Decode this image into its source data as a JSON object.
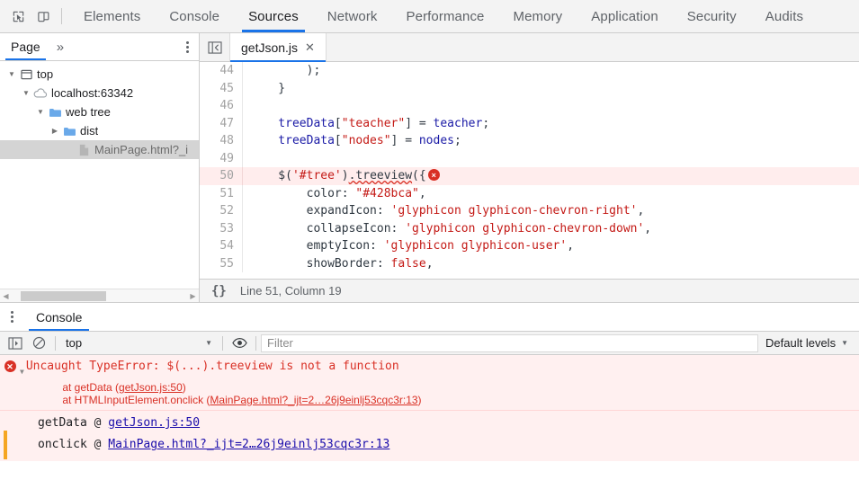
{
  "toolbar": {
    "inspect_icon": "inspect-cursor-icon",
    "device_icon": "device-toolbar-icon",
    "tabs": [
      {
        "label": "Elements",
        "active": false
      },
      {
        "label": "Console",
        "active": false
      },
      {
        "label": "Sources",
        "active": true
      },
      {
        "label": "Network",
        "active": false
      },
      {
        "label": "Performance",
        "active": false
      },
      {
        "label": "Memory",
        "active": false
      },
      {
        "label": "Application",
        "active": false
      },
      {
        "label": "Security",
        "active": false
      },
      {
        "label": "Audits",
        "active": false
      }
    ],
    "accent_color": "#1a73e8"
  },
  "navigator": {
    "tab_label": "Page",
    "more_label": "»",
    "menu_icon": "more-options-icon",
    "tree": [
      {
        "label": "top",
        "icon": "frame-icon",
        "twisty": "▼",
        "indent": 6,
        "selected": false
      },
      {
        "label": "localhost:63342",
        "icon": "cloud-icon",
        "twisty": "▼",
        "indent": 22,
        "selected": false
      },
      {
        "label": "web tree",
        "icon": "folder-icon",
        "twisty": "▼",
        "indent": 38,
        "selected": false
      },
      {
        "label": "dist",
        "icon": "folder-icon",
        "twisty": "▶",
        "indent": 54,
        "selected": false
      },
      {
        "label": "MainPage.html?_i",
        "icon": "file-icon",
        "twisty": "",
        "indent": 70,
        "selected": true
      }
    ]
  },
  "editor": {
    "panel_toggle_icon": "show-navigator-icon",
    "tab": {
      "label": "getJson.js",
      "close_icon": "close-icon"
    },
    "lines": [
      {
        "num": "44",
        "error": false,
        "tokens": [
          {
            "t": "        );",
            "c": "plain"
          }
        ]
      },
      {
        "num": "45",
        "error": false,
        "tokens": [
          {
            "t": "    }",
            "c": "plain"
          }
        ]
      },
      {
        "num": "46",
        "error": false,
        "tokens": [
          {
            "t": "",
            "c": "plain"
          }
        ]
      },
      {
        "num": "47",
        "error": false,
        "tokens": [
          {
            "t": "    treeData",
            "c": "id"
          },
          {
            "t": "[",
            "c": "plain"
          },
          {
            "t": "\"teacher\"",
            "c": "str"
          },
          {
            "t": "] = ",
            "c": "plain"
          },
          {
            "t": "teacher",
            "c": "id"
          },
          {
            "t": ";",
            "c": "plain"
          }
        ]
      },
      {
        "num": "48",
        "error": false,
        "tokens": [
          {
            "t": "    treeData",
            "c": "id"
          },
          {
            "t": "[",
            "c": "plain"
          },
          {
            "t": "\"nodes\"",
            "c": "str"
          },
          {
            "t": "] = ",
            "c": "plain"
          },
          {
            "t": "nodes",
            "c": "id"
          },
          {
            "t": ";",
            "c": "plain"
          }
        ]
      },
      {
        "num": "49",
        "error": false,
        "tokens": [
          {
            "t": "",
            "c": "plain"
          }
        ]
      },
      {
        "num": "50",
        "error": true,
        "tokens": [
          {
            "t": "    $(",
            "c": "plain"
          },
          {
            "t": "'#tree'",
            "c": "str"
          },
          {
            "t": ")",
            "c": "plain"
          },
          {
            "t": ".treeview",
            "c": "squig"
          },
          {
            "t": "({",
            "c": "plain"
          }
        ],
        "badge": "×"
      },
      {
        "num": "51",
        "error": false,
        "tokens": [
          {
            "t": "        color: ",
            "c": "plain"
          },
          {
            "t": "\"#428bca\"",
            "c": "str"
          },
          {
            "t": ",",
            "c": "plain"
          }
        ]
      },
      {
        "num": "52",
        "error": false,
        "tokens": [
          {
            "t": "        expandIcon: ",
            "c": "plain"
          },
          {
            "t": "'glyphicon glyphicon-chevron-right'",
            "c": "str"
          },
          {
            "t": ",",
            "c": "plain"
          }
        ]
      },
      {
        "num": "53",
        "error": false,
        "tokens": [
          {
            "t": "        collapseIcon: ",
            "c": "plain"
          },
          {
            "t": "'glyphicon glyphicon-chevron-down'",
            "c": "str"
          },
          {
            "t": ",",
            "c": "plain"
          }
        ]
      },
      {
        "num": "54",
        "error": false,
        "tokens": [
          {
            "t": "        emptyIcon: ",
            "c": "plain"
          },
          {
            "t": "'glyphicon glyphicon-user'",
            "c": "str"
          },
          {
            "t": ",",
            "c": "plain"
          }
        ]
      },
      {
        "num": "55",
        "error": false,
        "tokens": [
          {
            "t": "        showBorder: ",
            "c": "plain"
          },
          {
            "t": "false",
            "c": "kw"
          },
          {
            "t": ",",
            "c": "plain"
          }
        ]
      }
    ],
    "status": {
      "pretty_print_icon": "{}",
      "cursor_position": "Line 51, Column 19"
    }
  },
  "drawer": {
    "menu_icon": "more-options-icon",
    "tabs": [
      {
        "label": "Console",
        "active": true
      }
    ],
    "console_toolbar": {
      "sidebar_icon": "console-sidebar-icon",
      "clear_icon": "clear-console-icon",
      "context": "top",
      "eye_icon": "live-expression-icon",
      "filter_placeholder": "Filter",
      "filter_value": "",
      "levels_label": "Default levels"
    },
    "messages": {
      "error": {
        "icon": "error-icon",
        "expand_triangle": "▼",
        "title": "Uncaught TypeError: $(...).treeview is not a function",
        "frames": [
          {
            "prefix": "    at getData (",
            "link": "getJson.js:50",
            "suffix": ")"
          },
          {
            "prefix": "    at HTMLInputElement.onclick (",
            "link": "MainPage.html?_ijt=2…26j9einlj53cqc3r:13",
            "suffix": ")"
          }
        ]
      },
      "stack": [
        {
          "prefix": "getData @ ",
          "link": "getJson.js:50"
        },
        {
          "prefix": "onclick @ ",
          "link": "MainPage.html?_ijt=2…26j9einlj53cqc3r:13"
        }
      ]
    }
  }
}
